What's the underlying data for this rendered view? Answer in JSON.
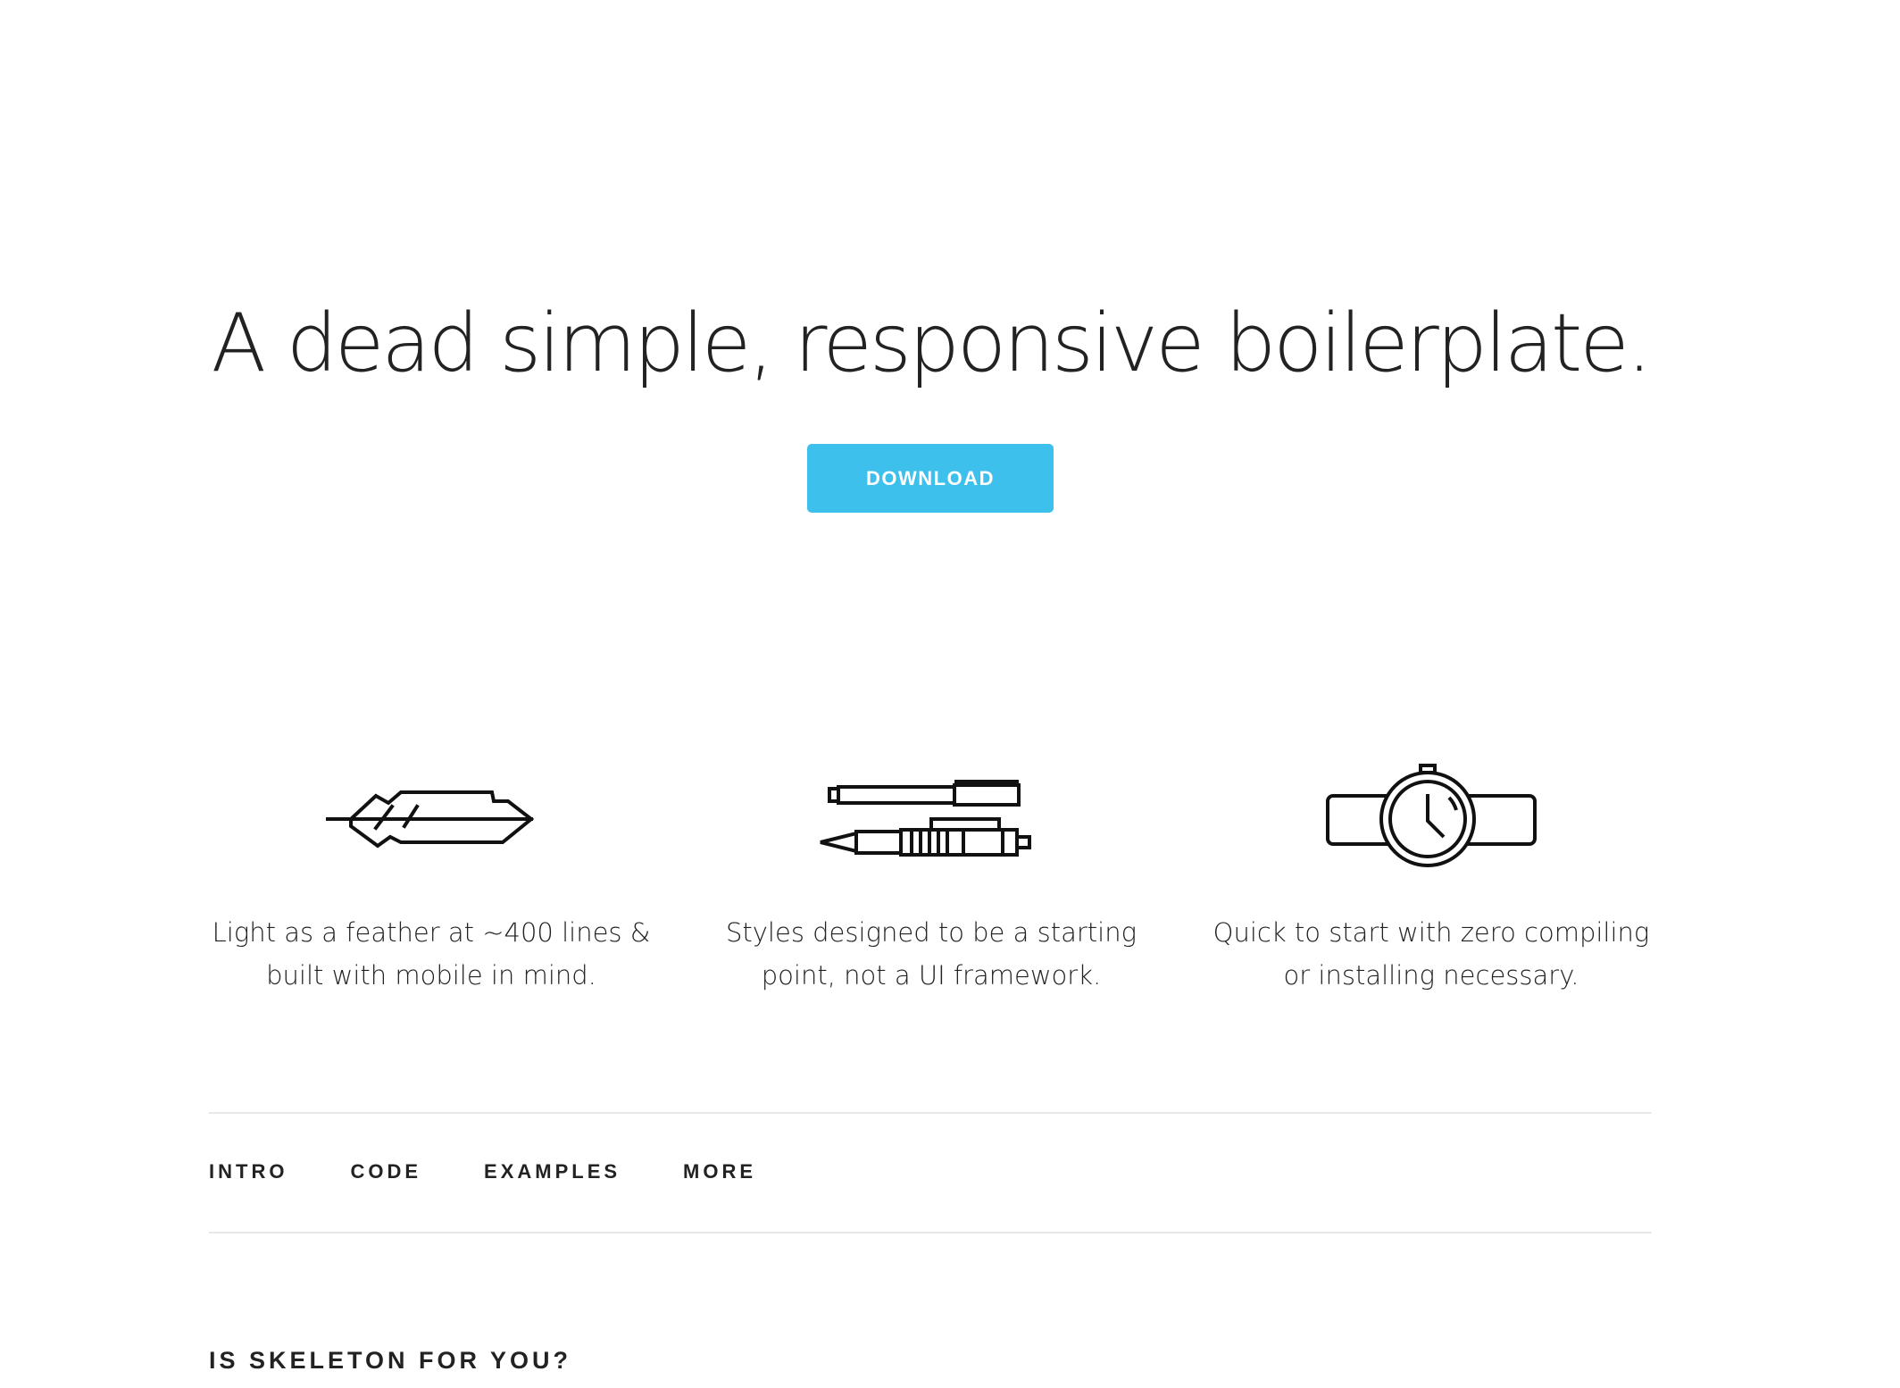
{
  "hero": {
    "heading": "A dead simple, responsive boilerplate.",
    "download_label": "DOWNLOAD",
    "accent_color": "#3ec0ed"
  },
  "features": [
    {
      "icon": "feather-icon",
      "line1": "Light as a feather at ~400 lines &",
      "line2": "built with mobile in mind."
    },
    {
      "icon": "pens-icon",
      "line1": "Styles designed to be a starting",
      "line2": "point, not a UI framework."
    },
    {
      "icon": "watch-icon",
      "line1": "Quick to start with zero compiling",
      "line2": "or installing necessary."
    }
  ],
  "nav": {
    "items": [
      "INTRO",
      "CODE",
      "EXAMPLES",
      "MORE"
    ]
  },
  "section": {
    "heading": "IS SKELETON FOR YOU?"
  }
}
